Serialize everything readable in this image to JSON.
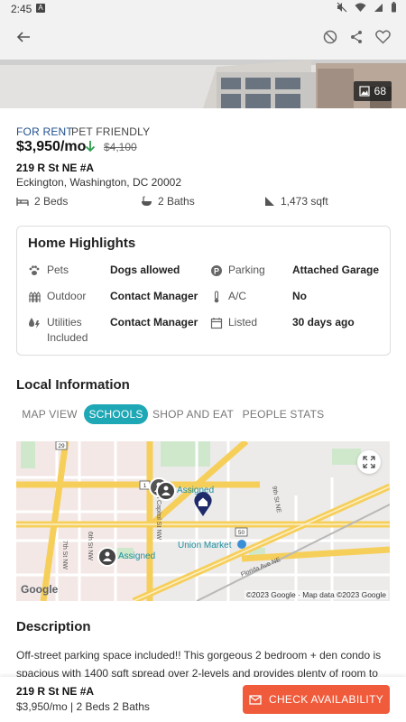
{
  "status_bar": {
    "time": "2:45"
  },
  "hero": {
    "photo_count": "68"
  },
  "listing": {
    "tags": [
      "FOR RENT",
      "PET FRIENDLY"
    ],
    "price": "$3,950/mo",
    "old_price": "$4,100",
    "street": "219 R St NE #A",
    "city_line": "Eckington, Washington, DC 20002",
    "beds": "2 Beds",
    "baths": "2 Baths",
    "sqft": "1,473 sqft"
  },
  "highlights": {
    "title": "Home Highlights",
    "items": [
      {
        "icon": "paw-icon",
        "label": "Pets",
        "value": "Dogs allowed"
      },
      {
        "icon": "parking-icon",
        "label": "Parking",
        "value": "Attached Garage"
      },
      {
        "icon": "fence-icon",
        "label": "Outdoor",
        "value": "Contact Manager"
      },
      {
        "icon": "thermometer-icon",
        "label": "A/C",
        "value": "No"
      },
      {
        "icon": "utilities-icon",
        "label": "Utilities Included",
        "label_line1": "Utilities",
        "label_line2": "Included",
        "value": "Contact Manager"
      },
      {
        "icon": "calendar-icon",
        "label": "Listed",
        "value": "30 days ago"
      }
    ]
  },
  "local_info": {
    "title": "Local Information",
    "tabs": [
      "MAP VIEW",
      "SCHOOLS",
      "SHOP AND EAT",
      "PEOPLE STATS"
    ],
    "active_tab": "SCHOOLS",
    "map": {
      "labels": {
        "assigned_1": "Assigned",
        "assigned_2": "Assigned",
        "union_market": "Union Market",
        "north_capitol": "North Capitol St NW",
        "seventh_st": "7th St NW",
        "sixth_st": "6th St NW",
        "ninth_st": "9th St NE",
        "florida_ave": "Florida Ave NE",
        "route_29": "29",
        "route_1": "1",
        "route_50": "50"
      },
      "logo": "Google",
      "attribution": "©2023 Google · Map data ©2023 Google"
    }
  },
  "description": {
    "title": "Description",
    "line1": "Off-street parking space included!! This gorgeous 2 bedroom + den condo is",
    "line2": "spacious with 1400 sqft spread over 2-levels and provides plenty of room to live,"
  },
  "bottom_bar": {
    "street": "219 R St NE #A",
    "summary": "$3,950/mo | 2 Beds 2 Baths",
    "cta_label": "CHECK AVAILABILITY"
  },
  "colors": {
    "accent_teal": "#1ea7b5",
    "cta_orange": "#ef5b3b",
    "tag_blue": "#1f4e8c",
    "price_down_green": "#2e9e4f",
    "map_pin_navy": "#1f2a6b"
  }
}
